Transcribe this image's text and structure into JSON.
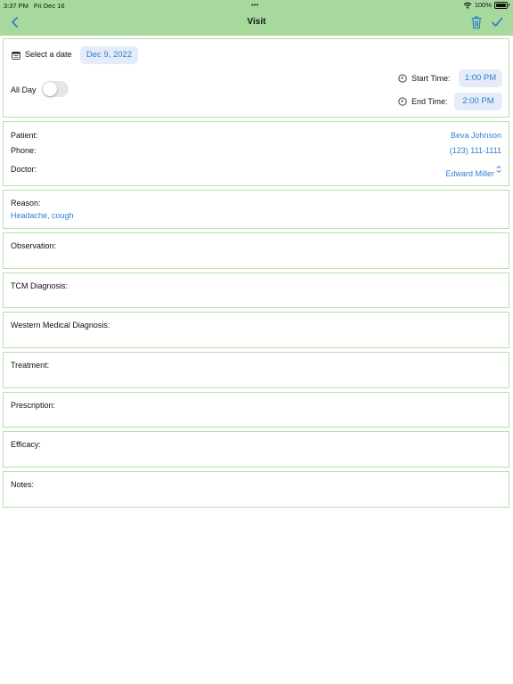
{
  "status_bar": {
    "time": "3:37 PM",
    "date": "Fri Dec 16",
    "dots": "•••",
    "battery": "100%"
  },
  "nav": {
    "title": "Visit"
  },
  "datetime": {
    "select_date_label": "Select a date",
    "date_value": "Dec 9, 2022",
    "all_day_label": "All Day",
    "all_day_on": false,
    "start_label": "Start Time:",
    "start_value": "1:00 PM",
    "end_label": "End Time:",
    "end_value": "2:00 PM"
  },
  "info": {
    "patient_label": "Patient:",
    "patient_value": "Beva Johnson",
    "phone_label": "Phone:",
    "phone_value": "(123) 111-1111",
    "doctor_label": "Doctor:",
    "doctor_value": "Edward Miller"
  },
  "reason": {
    "label": "Reason:",
    "value": "Headache, cough"
  },
  "fields": [
    {
      "label": "Observation:"
    },
    {
      "label": "TCM Diagnosis:"
    },
    {
      "label": "Western Medical Diagnosis:"
    },
    {
      "label": "Treatment:"
    },
    {
      "label": "Prescription:"
    },
    {
      "label": "Efficacy:"
    },
    {
      "label": "Notes:"
    }
  ],
  "colors": {
    "accent": "#2f7fd4",
    "nav_bg": "#a6d99b",
    "card_border": "#b6e0ac",
    "pill_bg": "#e3ecf8"
  }
}
